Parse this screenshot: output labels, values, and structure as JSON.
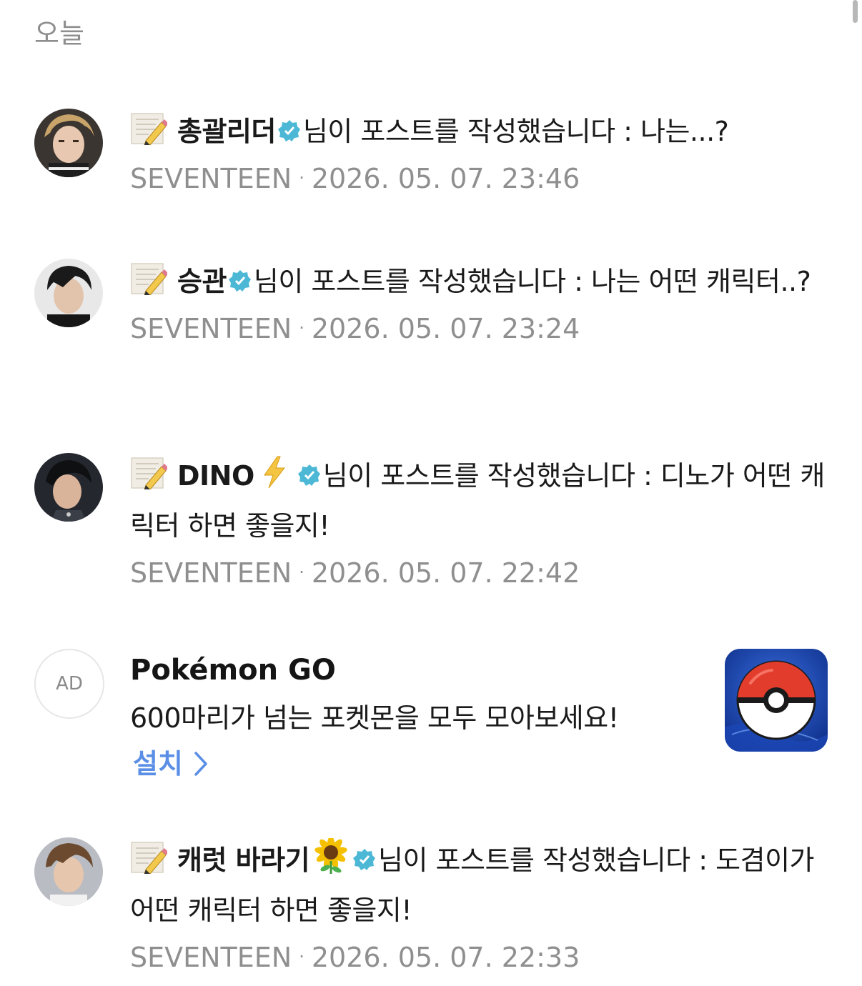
{
  "section": {
    "label": "오늘"
  },
  "notifications": [
    {
      "name": "총괄리더",
      "name_emoji": "",
      "message": "님이 포스트를 작성했습니다 : 나는...?",
      "source": "SEVENTEEN",
      "timestamp": "2026. 05. 07. 23:46"
    },
    {
      "name": "승관",
      "name_emoji": "",
      "message": "님이 포스트를 작성했습니다 : 나는 어떤 캐릭터..?",
      "source": "SEVENTEEN",
      "timestamp": "2026. 05. 07. 23:24"
    },
    {
      "name": "DINO",
      "name_emoji": "⚡",
      "message": "님이 포스트를 작성했습니다 : 디노가 어떤 캐릭터 하면 좋을지!",
      "source": "SEVENTEEN",
      "timestamp": "2026. 05. 07. 22:42"
    },
    {
      "name": "캐럿 바라기",
      "name_emoji": "🌻",
      "message": "님이 포스트를 작성했습니다 : 도겸이가 어떤 캐릭터 하면 좋을지!",
      "source": "SEVENTEEN",
      "timestamp": "2026. 05. 07. 22:33"
    }
  ],
  "ad": {
    "badge": "AD",
    "title": "Pokémon GO",
    "description": "600마리가 넘는 포켓몬을 모두 모아보세요!",
    "install_label": "설치",
    "icon": "pokeball-icon"
  },
  "colors": {
    "verified": "#4cb8d6",
    "install": "#5b8fe6",
    "meta": "#8f8f8f"
  }
}
